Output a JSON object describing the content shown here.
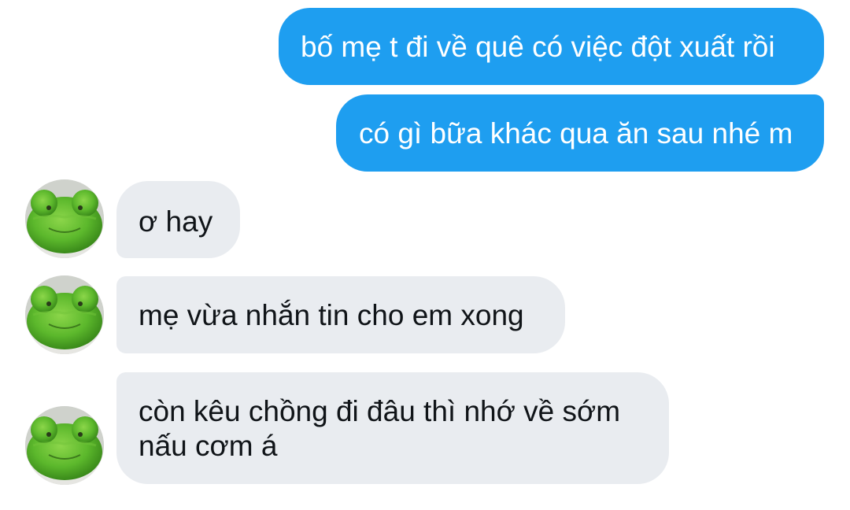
{
  "colors": {
    "sent_bubble": "#1e9ef0",
    "received_bubble": "#e9ecf0",
    "sent_text": "#ffffff",
    "received_text": "#101418",
    "background": "#ffffff"
  },
  "avatar": {
    "icon": "green-frog-plush-avatar"
  },
  "messages": [
    {
      "direction": "sent",
      "text": "bố mẹ t đi về quê có việc đột xuất rồi"
    },
    {
      "direction": "sent",
      "text": "có gì bữa khác qua ăn sau nhé m"
    },
    {
      "direction": "received",
      "text": "ơ hay"
    },
    {
      "direction": "received",
      "text": "mẹ vừa nhắn tin cho em xong"
    },
    {
      "direction": "received",
      "lines": [
        "còn kêu chồng đi đâu thì nhớ về sớm",
        "nấu cơm á"
      ]
    }
  ]
}
